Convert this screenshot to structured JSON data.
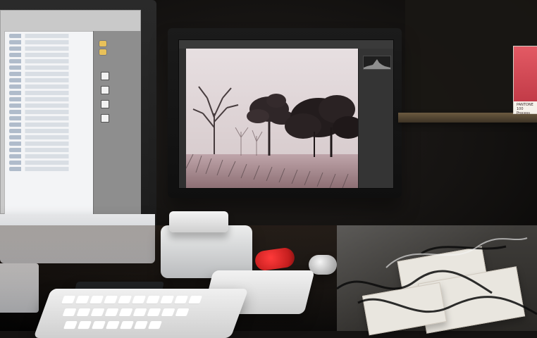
{
  "scene": {
    "left_monitor": {
      "app": "file_browser",
      "dominant_color": "#c9c9c9"
    },
    "right_monitor": {
      "app": "photo_editor",
      "canvas_color": "#ddd2d4"
    },
    "shelf_item": {
      "card_text_line1": "PANTONE",
      "card_text_line2": "100 Process"
    },
    "desk": {
      "keyboard_color": "#f2f2f2",
      "trackpad_color": "#e6e6e6"
    }
  }
}
